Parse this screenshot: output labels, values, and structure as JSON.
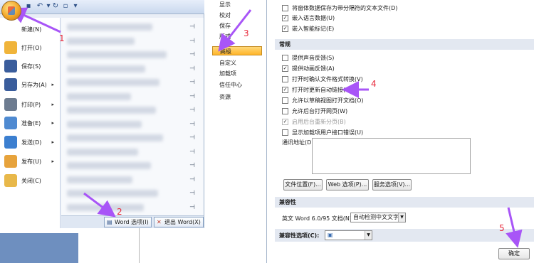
{
  "office_menu": {
    "items": [
      {
        "label": "新建(N)",
        "icon": "new-document-icon",
        "color": "#ffffff",
        "arrow": false
      },
      {
        "label": "打开(O)",
        "icon": "open-folder-icon",
        "color": "#f0b43a",
        "arrow": false
      },
      {
        "label": "保存(S)",
        "icon": "save-disk-icon",
        "color": "#3a5d9c",
        "arrow": false
      },
      {
        "label": "另存为(A)",
        "icon": "save-as-icon",
        "color": "#3a5d9c",
        "arrow": true
      },
      {
        "label": "打印(P)",
        "icon": "print-icon",
        "color": "#6d7c90",
        "arrow": true
      },
      {
        "label": "准备(E)",
        "icon": "prepare-icon",
        "color": "#4f8ad1",
        "arrow": true
      },
      {
        "label": "发送(D)",
        "icon": "send-icon",
        "color": "#3c7fd0",
        "arrow": true
      },
      {
        "label": "发布(U)",
        "icon": "publish-icon",
        "color": "#e7a33c",
        "arrow": true
      },
      {
        "label": "关闭(C)",
        "icon": "close-folder-icon",
        "color": "#e8b84a",
        "arrow": false
      }
    ],
    "recent_rows": 14,
    "word_options_label": "Word 选项(I)",
    "exit_word_label": "退出 Word(X)"
  },
  "options_nav": {
    "items": [
      "显示",
      "校对",
      "保存",
      "版式",
      "高级",
      "自定义",
      "加载项",
      "信任中心",
      "资源"
    ],
    "active_index": 4
  },
  "options_content": {
    "top_options": [
      {
        "label": "将窗体数据保存为带分隔符的文本文件(D)",
        "checked": false
      },
      {
        "label": "嵌入语言数据(U)",
        "checked": true
      },
      {
        "label": "嵌入智能标记(E)",
        "checked": true
      }
    ],
    "general_header": "常规",
    "general_options": [
      {
        "label": "提供声音反馈(S)",
        "checked": false,
        "disabled": false
      },
      {
        "label": "提供动画反馈(A)",
        "checked": true,
        "disabled": false
      },
      {
        "label": "打开时确认文件格式转换(V)",
        "checked": false,
        "disabled": false
      },
      {
        "label": "打开时更新自动链接(U)",
        "checked": true,
        "disabled": false
      },
      {
        "label": "允许以草稿视图打开文档(O)",
        "checked": false,
        "disabled": false
      },
      {
        "label": "允许后台打开网页(W)",
        "checked": false,
        "disabled": false
      },
      {
        "label": "启用后台重新分页(B)",
        "checked": true,
        "disabled": true
      },
      {
        "label": "显示加载项用户接口错误(U)",
        "checked": false,
        "disabled": false
      }
    ],
    "mailing_address_label": "通讯地址(D):",
    "buttons": {
      "file_locations": "文件位置(F)...",
      "web_options": "Web 选项(P)...",
      "service_options": "服务选项(V)..."
    },
    "compat_header": "兼容性",
    "compat_label": "英文 Word 6.0/95 文档(N):",
    "compat_value": "自动检测中文文字",
    "compat_options_label": "兼容性选项(C):",
    "ok_label": "确定"
  },
  "annotations": {
    "labels": [
      "1",
      "2",
      "3",
      "4",
      "5"
    ],
    "color": "#e8283a"
  }
}
